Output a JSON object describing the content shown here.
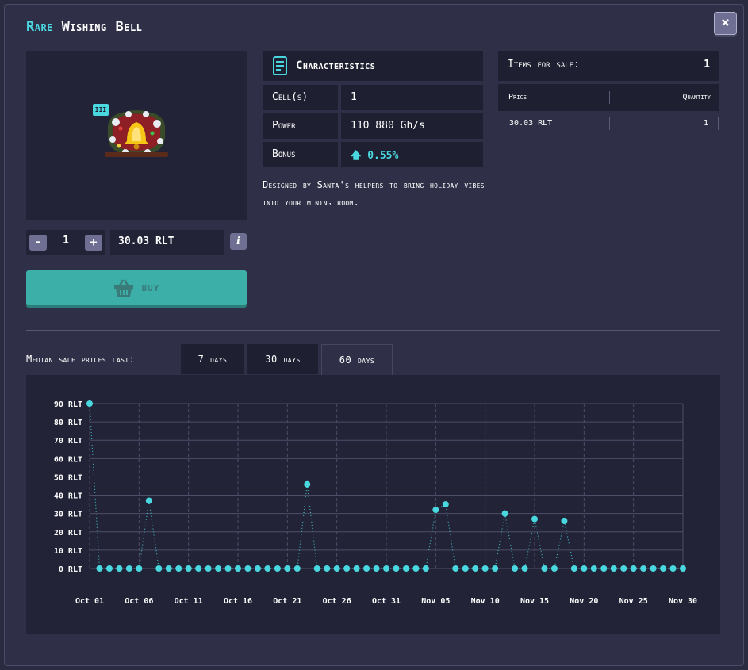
{
  "title": {
    "rarity": "Rare",
    "name": "Wishing Bell"
  },
  "close_icon": "×",
  "level_badge": "III",
  "quantity": {
    "minus": "-",
    "value": "1",
    "plus": "+"
  },
  "price": "30.03 RLT",
  "info_icon": "i",
  "buy_label": "BUY",
  "characteristics": {
    "title": "Characteristics",
    "rows": [
      {
        "label": "Cell(s)",
        "value": "1"
      },
      {
        "label": "Power",
        "value": "110 880 Gh/s"
      },
      {
        "label": "Bonus",
        "value": "0.55%"
      }
    ],
    "description": "Designed by Santa's helpers to bring holiday vibes into your mining room."
  },
  "sale": {
    "header_label": "Items for sale:",
    "header_count": "1",
    "col_price": "Price",
    "col_quantity": "Quantity",
    "rows": [
      {
        "price": "30.03 RLT",
        "quantity": "1"
      }
    ]
  },
  "median": {
    "label": "Median sale prices last:",
    "tabs": [
      "7 days",
      "30 days",
      "60 days"
    ],
    "active_tab": "60 days"
  },
  "chart_data": {
    "type": "line",
    "line_style": "dotted",
    "marker": "circle",
    "color": "#4ad8e0",
    "ylim": [
      0,
      90
    ],
    "y_ticks": [
      "0 RLT",
      "10 RLT",
      "20 RLT",
      "30 RLT",
      "40 RLT",
      "50 RLT",
      "60 RLT",
      "70 RLT",
      "80 RLT",
      "90 RLT"
    ],
    "x_ticks": [
      "Oct 01",
      "Oct 06",
      "Oct 11",
      "Oct 16",
      "Oct 21",
      "Oct 26",
      "Oct 31",
      "Nov 05",
      "Nov 10",
      "Nov 15",
      "Nov 20",
      "Nov 25",
      "Nov 30"
    ],
    "x_start": "Oct 01",
    "x_end": "Nov 30",
    "values": [
      90,
      0,
      0,
      0,
      0,
      0,
      37,
      0,
      0,
      0,
      0,
      0,
      0,
      0,
      0,
      0,
      0,
      0,
      0,
      0,
      0,
      0,
      46,
      0,
      0,
      0,
      0,
      0,
      0,
      0,
      0,
      0,
      0,
      0,
      0,
      32,
      35,
      0,
      0,
      0,
      0,
      0,
      30,
      0,
      0,
      27,
      0,
      0,
      26,
      0,
      0,
      0,
      0,
      0,
      0,
      0,
      0,
      0,
      0,
      0,
      0
    ],
    "grid": true
  }
}
